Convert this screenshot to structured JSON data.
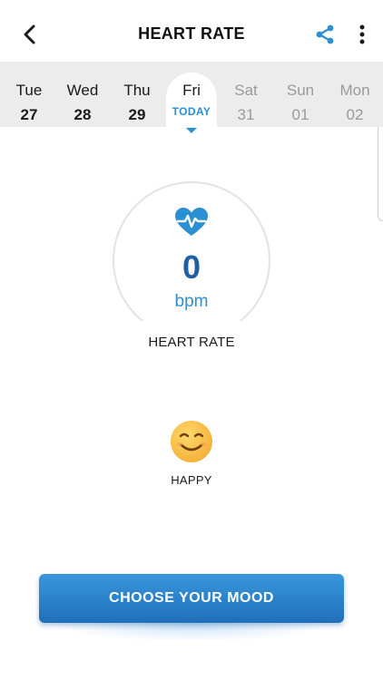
{
  "header": {
    "title": "HEART RATE",
    "back_icon": "chevron-left-icon",
    "share_icon": "share-icon",
    "more_icon": "more-vertical-icon"
  },
  "date_strip": {
    "days": [
      {
        "name": "Tue",
        "num": "27",
        "state": "past"
      },
      {
        "name": "Wed",
        "num": "28",
        "state": "past"
      },
      {
        "name": "Thu",
        "num": "29",
        "state": "past"
      },
      {
        "name": "Fri",
        "num": "TODAY",
        "state": "selected"
      },
      {
        "name": "Sat",
        "num": "31",
        "state": "future"
      },
      {
        "name": "Sun",
        "num": "01",
        "state": "future"
      },
      {
        "name": "Mon",
        "num": "02",
        "state": "future"
      }
    ]
  },
  "heart_rate": {
    "value": "0",
    "unit": "bpm",
    "label": "HEART RATE",
    "icon": "heart-pulse-icon"
  },
  "mood": {
    "label": "HAPPY",
    "icon": "happy-face-icon"
  },
  "cta": {
    "label": "CHOOSE YOUR MOOD"
  },
  "colors": {
    "accent": "#2a8fd3",
    "value": "#1f5fa5",
    "strip_bg": "#ececec",
    "future_text": "#9a9a9a"
  }
}
